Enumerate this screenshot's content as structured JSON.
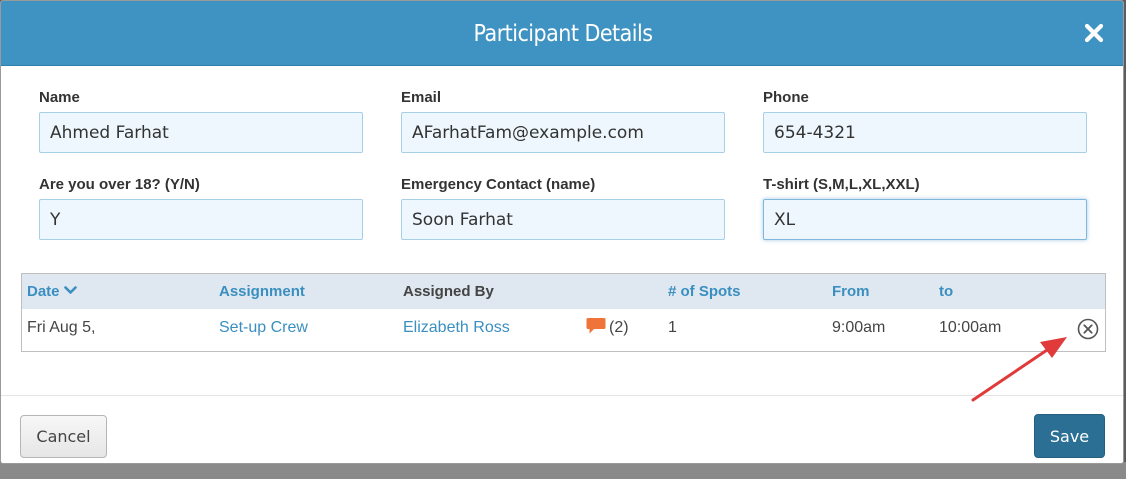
{
  "modal": {
    "title": "Participant Details",
    "close_icon": "close-icon"
  },
  "form": {
    "name": {
      "label": "Name",
      "value": "Ahmed Farhat"
    },
    "email": {
      "label": "Email",
      "value": "AFarhatFam@example.com"
    },
    "phone": {
      "label": "Phone",
      "value": "654-4321"
    },
    "over18": {
      "label": "Are you over 18? (Y/N)",
      "value": "Y"
    },
    "emergency": {
      "label": "Emergency Contact (name)",
      "value": "Soon Farhat"
    },
    "tshirt": {
      "label": "T-shirt (S,M,L,XL,XXL)",
      "value": "XL"
    }
  },
  "table": {
    "columns": {
      "date": "Date",
      "assignment": "Assignment",
      "assigned_by": "Assigned By",
      "spots": "# of Spots",
      "from": "From",
      "to": "to"
    },
    "rows": [
      {
        "date": "Fri Aug 5,",
        "assignment": "Set-up Crew",
        "assigned_by": "Elizabeth Ross",
        "comments": "(2)",
        "spots": "1",
        "from": "9:00am",
        "to": "10:00am"
      }
    ]
  },
  "footer": {
    "cancel_label": "Cancel",
    "save_label": "Save"
  },
  "colors": {
    "header": "#3e93c2",
    "link": "#3a8fc0",
    "save": "#2b6f94",
    "comment": "#f0743a",
    "annotation_arrow": "#e03a3a"
  },
  "icons": {
    "sort": "chevron-down-icon",
    "comment": "comment-icon",
    "remove": "remove-circle-icon"
  }
}
